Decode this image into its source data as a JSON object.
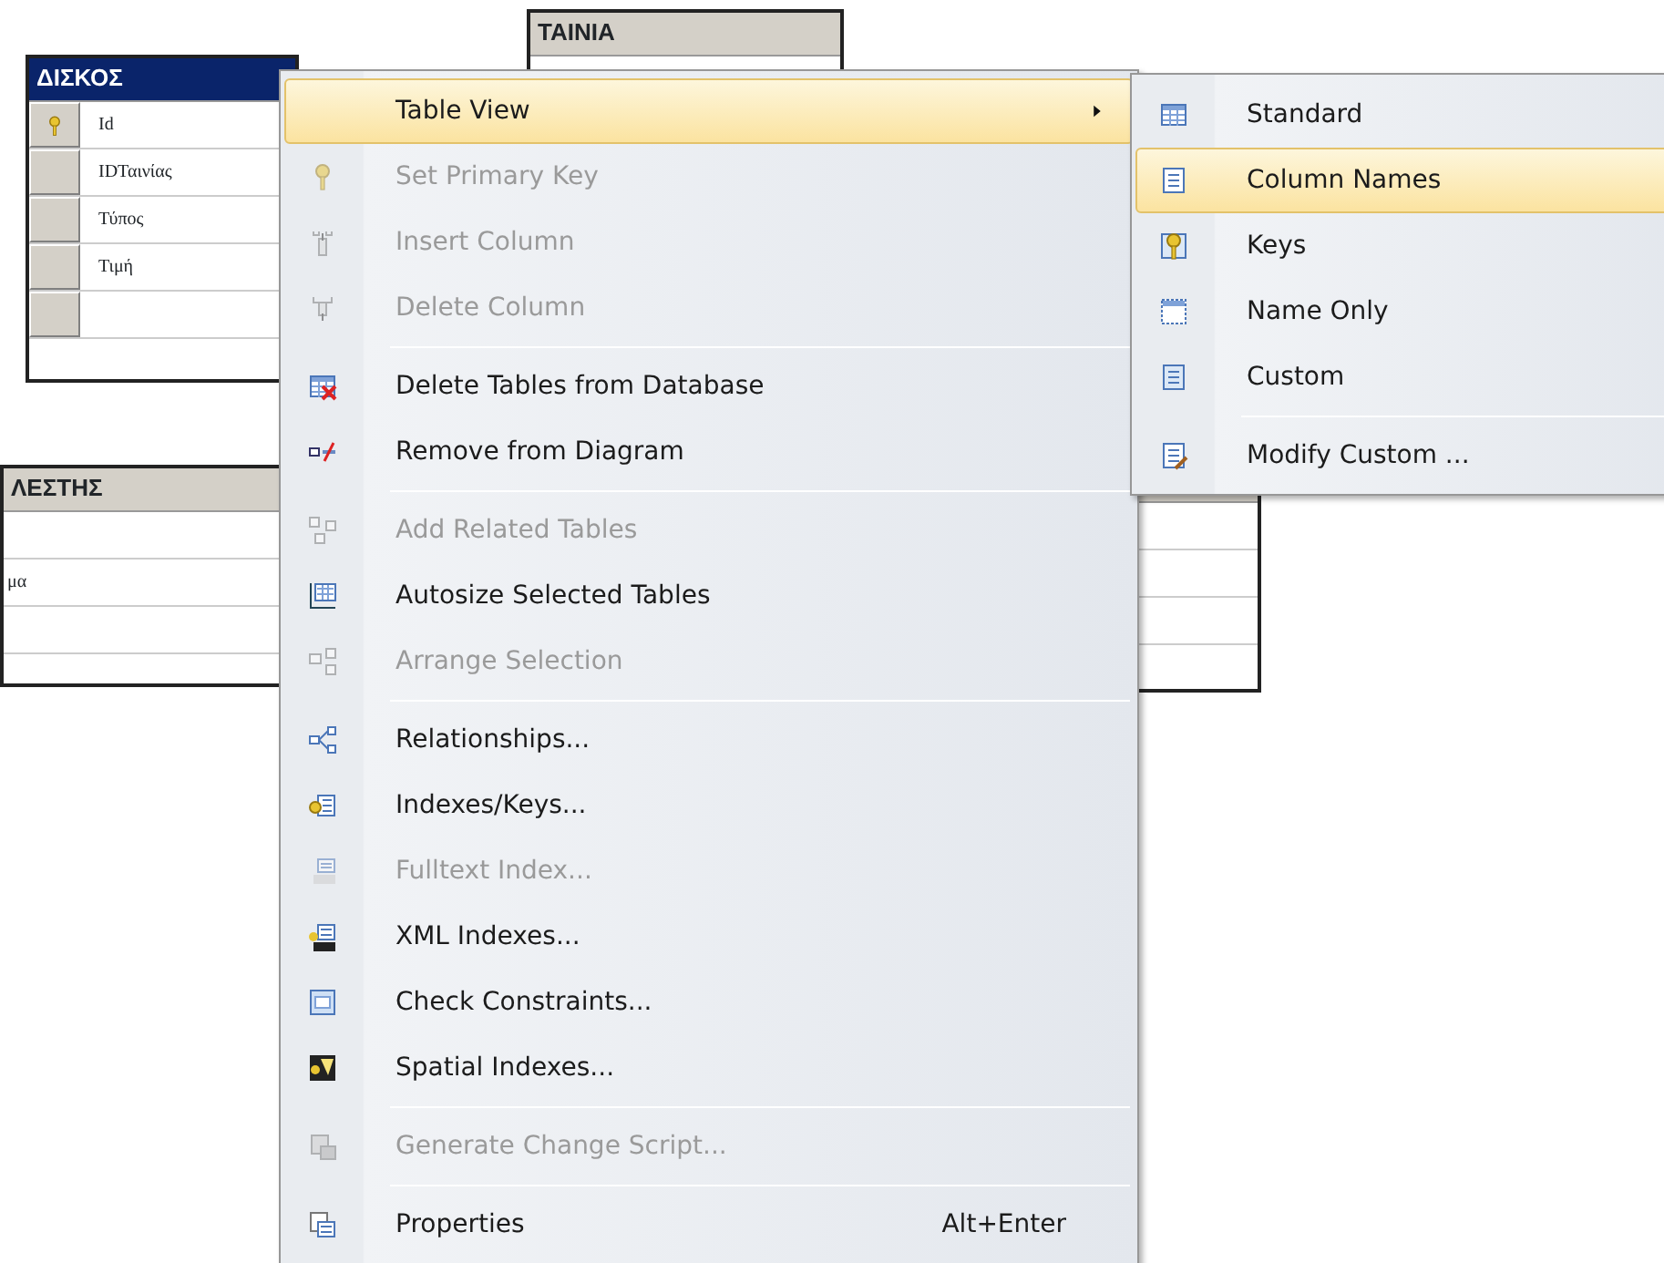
{
  "diagram": {
    "tables": [
      {
        "title": "ΔΙΣΚΟΣ",
        "selected": true,
        "rows": [
          {
            "name": "Id",
            "primary_key": true
          },
          {
            "name": "IDΤαινίας",
            "primary_key": false
          },
          {
            "name": "Τύπος",
            "primary_key": false
          },
          {
            "name": "Τιμή",
            "primary_key": false
          },
          {}
        ]
      },
      {
        "title": "ΤΑΙΝΙΑ",
        "selected": false
      },
      {
        "title": "ΛΕΣΤΗΣ",
        "selected": false,
        "rows": [
          {},
          {
            "name": "μα"
          },
          {}
        ]
      },
      {
        "selected": false,
        "rows": [
          {},
          {},
          {}
        ]
      }
    ]
  },
  "context_menu": {
    "items": [
      {
        "kind": "item",
        "label": "Table View",
        "disabled": false,
        "selected": true,
        "submenu": true
      },
      {
        "kind": "item",
        "label": "Set Primary Key",
        "disabled": true,
        "selected": false
      },
      {
        "kind": "item",
        "label": "Insert Column",
        "disabled": true,
        "selected": false
      },
      {
        "kind": "item",
        "label": "Delete Column",
        "disabled": true,
        "selected": false
      },
      {
        "kind": "separator"
      },
      {
        "kind": "item",
        "label": "Delete Tables from Database",
        "disabled": false,
        "selected": false
      },
      {
        "kind": "item",
        "label": "Remove from Diagram",
        "disabled": false,
        "selected": false
      },
      {
        "kind": "separator"
      },
      {
        "kind": "item",
        "label": "Add Related Tables",
        "disabled": true,
        "selected": false
      },
      {
        "kind": "item",
        "label": "Autosize Selected Tables",
        "disabled": false,
        "selected": false
      },
      {
        "kind": "item",
        "label": "Arrange Selection",
        "disabled": true,
        "selected": false
      },
      {
        "kind": "separator"
      },
      {
        "kind": "item",
        "label": "Relationships...",
        "disabled": false,
        "selected": false
      },
      {
        "kind": "item",
        "label": "Indexes/Keys...",
        "disabled": false,
        "selected": false
      },
      {
        "kind": "item",
        "label": "Fulltext Index...",
        "disabled": true,
        "selected": false
      },
      {
        "kind": "item",
        "label": "XML Indexes...",
        "disabled": false,
        "selected": false
      },
      {
        "kind": "item",
        "label": "Check Constraints...",
        "disabled": false,
        "selected": false
      },
      {
        "kind": "item",
        "label": "Spatial Indexes...",
        "disabled": false,
        "selected": false
      },
      {
        "kind": "separator"
      },
      {
        "kind": "item",
        "label": "Generate Change Script...",
        "disabled": true,
        "selected": false
      },
      {
        "kind": "separator"
      },
      {
        "kind": "item",
        "label": "Properties",
        "disabled": false,
        "selected": false,
        "shortcut": "Alt+Enter"
      }
    ]
  },
  "submenu": {
    "items": [
      {
        "kind": "item",
        "label": "Standard",
        "selected": false
      },
      {
        "kind": "item",
        "label": "Column Names",
        "selected": true
      },
      {
        "kind": "item",
        "label": "Keys",
        "selected": false
      },
      {
        "kind": "item",
        "label": "Name Only",
        "selected": false
      },
      {
        "kind": "item",
        "label": "Custom",
        "selected": false
      },
      {
        "kind": "separator"
      },
      {
        "kind": "item",
        "label": "Modify Custom ...",
        "selected": false
      }
    ]
  }
}
